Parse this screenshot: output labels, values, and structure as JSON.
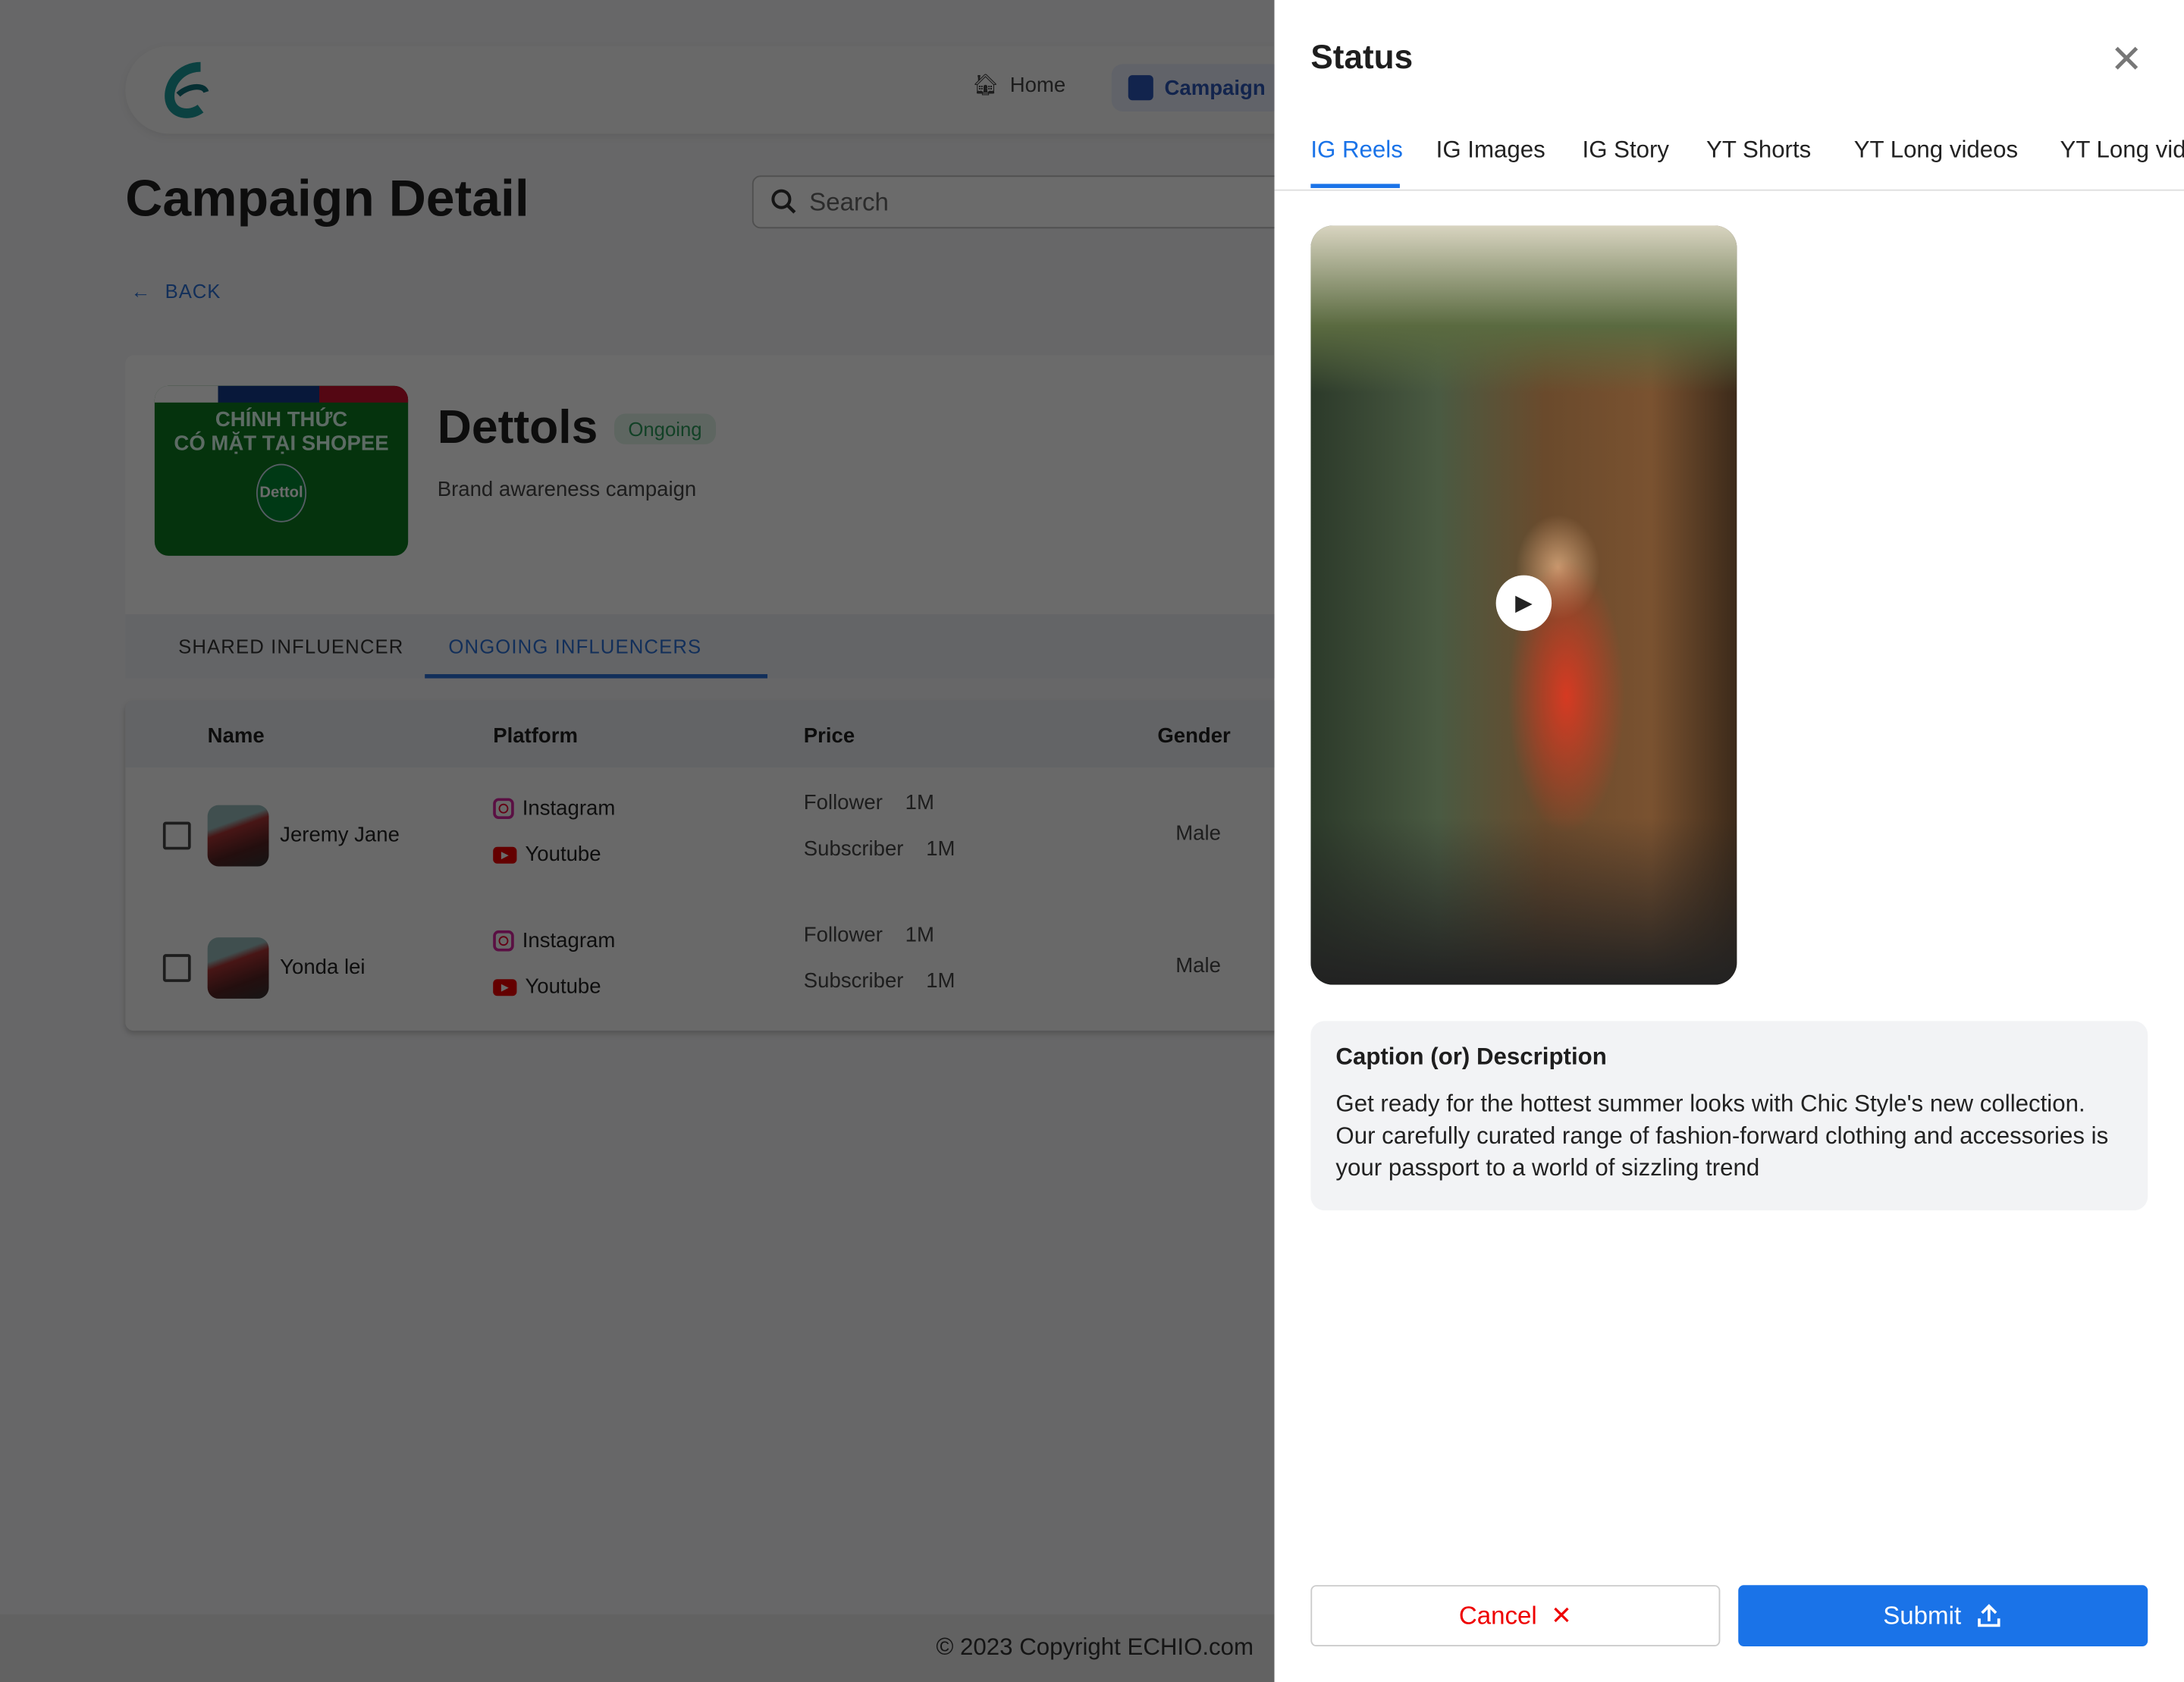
{
  "nav": {
    "home": "Home",
    "campaign": "Campaign"
  },
  "page": {
    "title": "Campaign Detail",
    "search_placeholder": "Search",
    "back": "BACK"
  },
  "campaign": {
    "name": "Dettols",
    "status": "Ongoing",
    "description": "Brand awareness campaign",
    "thumb_line1": "CHÍNH THỨC",
    "thumb_line2": "CÓ MẶT TẠI SHOPEE",
    "thumb_brand": "Dettol"
  },
  "tabs": [
    "SHARED INFLUENCER",
    "ONGOING INFLUENCERS"
  ],
  "table": {
    "headers": [
      "Name",
      "Platform",
      "Price",
      "Gender"
    ],
    "rows": [
      {
        "name": "Jeremy Jane",
        "platforms": [
          "Instagram",
          "Youtube"
        ],
        "follower_label": "Follower",
        "follower": "1M",
        "subscriber_label": "Subscriber",
        "subscriber": "1M",
        "gender": "Male"
      },
      {
        "name": "Yonda lei",
        "platforms": [
          "Instagram",
          "Youtube"
        ],
        "follower_label": "Follower",
        "follower": "1M",
        "subscriber_label": "Subscriber",
        "subscriber": "1M",
        "gender": "Male"
      }
    ]
  },
  "footer": "© 2023 Copyright ECHIO.com",
  "drawer": {
    "title": "Status",
    "tabs": [
      "IG Reels",
      "IG Images",
      "IG Story",
      "YT Shorts",
      "YT Long videos",
      "YT Long videos"
    ],
    "active_tab": "IG Reels",
    "caption_heading": "Caption (or) Description",
    "caption": "Get ready for the hottest summer looks with Chic Style's new collection. Our carefully curated range of fashion-forward clothing and accessories is your passport to a world of sizzling trend",
    "cancel": "Cancel",
    "submit": "Submit"
  },
  "colors": {
    "accent": "#1a73e8",
    "cancel": "#e00000",
    "ongoing": "#2a9a5a"
  }
}
